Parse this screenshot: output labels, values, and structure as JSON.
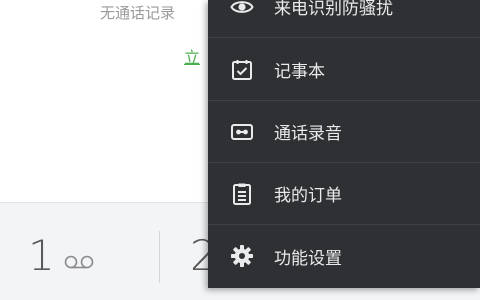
{
  "page": {
    "empty_message": "无通话记录",
    "action_link": "立"
  },
  "dialpad": {
    "keys": [
      {
        "digit": "1",
        "sub_icon": "voicemail-icon"
      },
      {
        "digit": "2",
        "sub_icon": ""
      }
    ]
  },
  "menu": {
    "items": [
      {
        "label": "来电识别防骚扰",
        "icon": "eye-icon"
      },
      {
        "label": "记事本",
        "icon": "notepad-check-icon"
      },
      {
        "label": "通话录音",
        "icon": "recording-icon"
      },
      {
        "label": "我的订单",
        "icon": "order-list-icon"
      },
      {
        "label": "功能设置",
        "icon": "gear-icon"
      }
    ]
  },
  "colors": {
    "menu_background": "#2e3033",
    "menu_text": "#e9eaeb",
    "link_green": "#4caf50",
    "dialpad_background": "#f3f4f6"
  }
}
